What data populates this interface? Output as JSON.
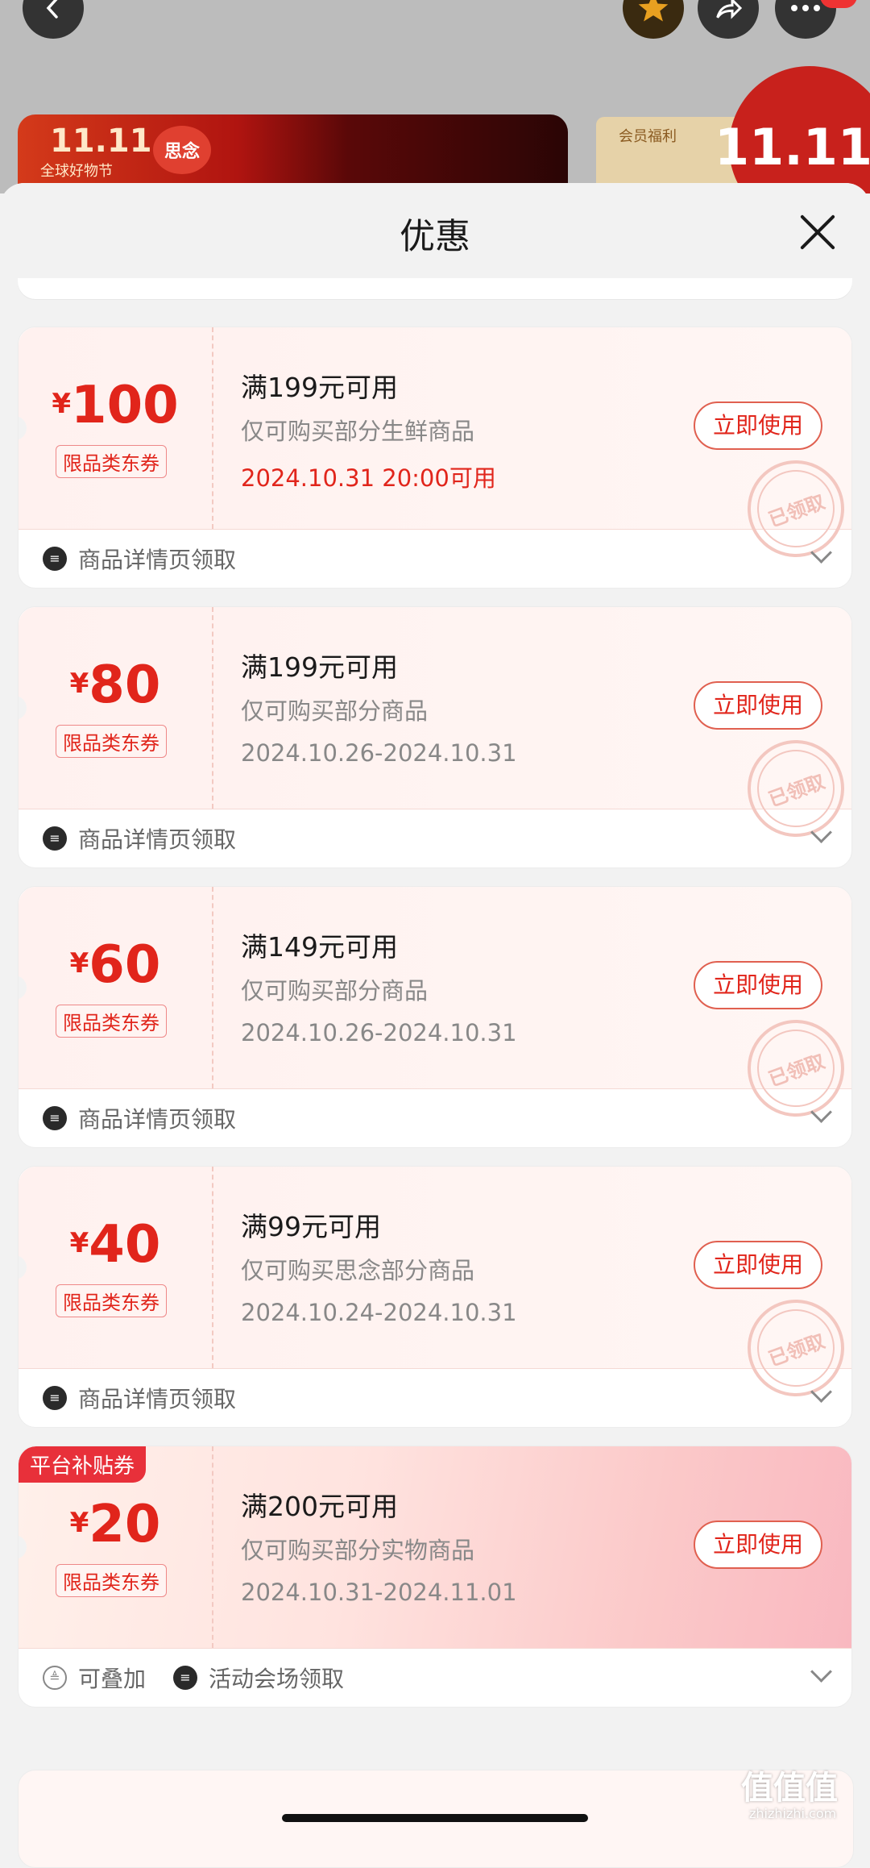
{
  "background_page": {
    "banner_logo": "11.11",
    "banner_sub": "全球好物节",
    "brand_badge": "思念",
    "member_label": "会员福利",
    "big_badge": "11.11"
  },
  "sheet": {
    "title": "优惠"
  },
  "coupons": [
    {
      "currency": "¥",
      "amount": "100",
      "tag": "限品类东券",
      "condition": "满199元可用",
      "scope": "仅可购买部分生鲜商品",
      "date": "2024.10.31 20:00可用",
      "use_label": "立即使用",
      "stamp": "已领取",
      "source": "商品详情页领取"
    },
    {
      "currency": "¥",
      "amount": "80",
      "tag": "限品类东券",
      "condition": "满199元可用",
      "scope": "仅可购买部分商品",
      "date": "2024.10.26-2024.10.31",
      "use_label": "立即使用",
      "stamp": "已领取",
      "source": "商品详情页领取"
    },
    {
      "currency": "¥",
      "amount": "60",
      "tag": "限品类东券",
      "condition": "满149元可用",
      "scope": "仅可购买部分商品",
      "date": "2024.10.26-2024.10.31",
      "use_label": "立即使用",
      "stamp": "已领取",
      "source": "商品详情页领取"
    },
    {
      "currency": "¥",
      "amount": "40",
      "tag": "限品类东券",
      "condition": "满99元可用",
      "scope": "仅可购买思念部分商品",
      "date": "2024.10.24-2024.10.31",
      "use_label": "立即使用",
      "stamp": "已领取",
      "source": "商品详情页领取"
    },
    {
      "platform_tag": "平台补贴券",
      "currency": "¥",
      "amount": "20",
      "tag": "限品类东券",
      "condition": "满200元可用",
      "scope": "仅可购买部分实物商品",
      "date": "2024.10.31-2024.11.01",
      "use_label": "立即使用",
      "stackable": "可叠加",
      "source": "活动会场领取"
    }
  ],
  "watermark": {
    "main": "值值值",
    "sub": "zhizhizhi.com"
  },
  "colors": {
    "accent": "#e1251b",
    "platform_tag": "#e8303a"
  }
}
